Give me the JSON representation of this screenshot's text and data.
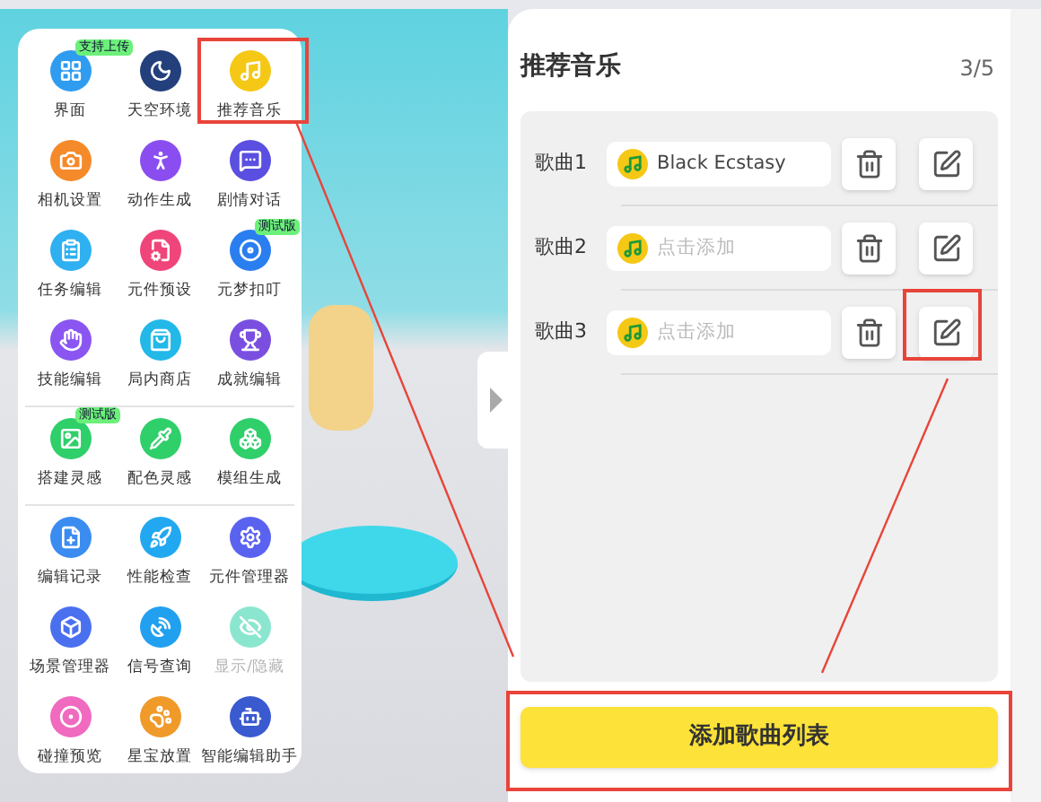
{
  "menu": {
    "groups": [
      {
        "items": [
          {
            "label": "界面",
            "badge": "支持上传",
            "disabled": false
          },
          {
            "label": "天空环境",
            "disabled": false
          },
          {
            "label": "推荐音乐",
            "disabled": false
          },
          {
            "label": "相机设置",
            "disabled": false
          },
          {
            "label": "动作生成",
            "disabled": false
          },
          {
            "label": "剧情对话",
            "disabled": false
          },
          {
            "label": "任务编辑",
            "disabled": false
          },
          {
            "label": "元件预设",
            "disabled": false
          },
          {
            "label": "元梦扣叮",
            "badge": "测试版",
            "disabled": false
          },
          {
            "label": "技能编辑",
            "disabled": false
          },
          {
            "label": "局内商店",
            "disabled": false
          },
          {
            "label": "成就编辑",
            "disabled": false
          }
        ]
      },
      {
        "items": [
          {
            "label": "搭建灵感",
            "badge": "测试版",
            "disabled": false
          },
          {
            "label": "配色灵感",
            "disabled": false
          },
          {
            "label": "模组生成",
            "disabled": false
          }
        ]
      },
      {
        "items": [
          {
            "label": "编辑记录",
            "disabled": false
          },
          {
            "label": "性能检查",
            "disabled": false
          },
          {
            "label": "元件管理器",
            "disabled": false
          },
          {
            "label": "场景管理器",
            "disabled": false
          },
          {
            "label": "信号查询",
            "disabled": false
          },
          {
            "label": "显示/隐藏",
            "disabled": true
          },
          {
            "label": "碰撞预览",
            "disabled": false
          },
          {
            "label": "星宝放置",
            "disabled": false
          },
          {
            "label": "智能编辑助手",
            "disabled": false
          }
        ]
      }
    ]
  },
  "panel": {
    "title": "推荐音乐",
    "count": "3/5",
    "songs": [
      {
        "label": "歌曲1",
        "value": "Black Ecstasy"
      },
      {
        "label": "歌曲2",
        "placeholder": "点击添加"
      },
      {
        "label": "歌曲3",
        "placeholder": "点击添加"
      }
    ],
    "add_button": "添加歌曲列表"
  }
}
